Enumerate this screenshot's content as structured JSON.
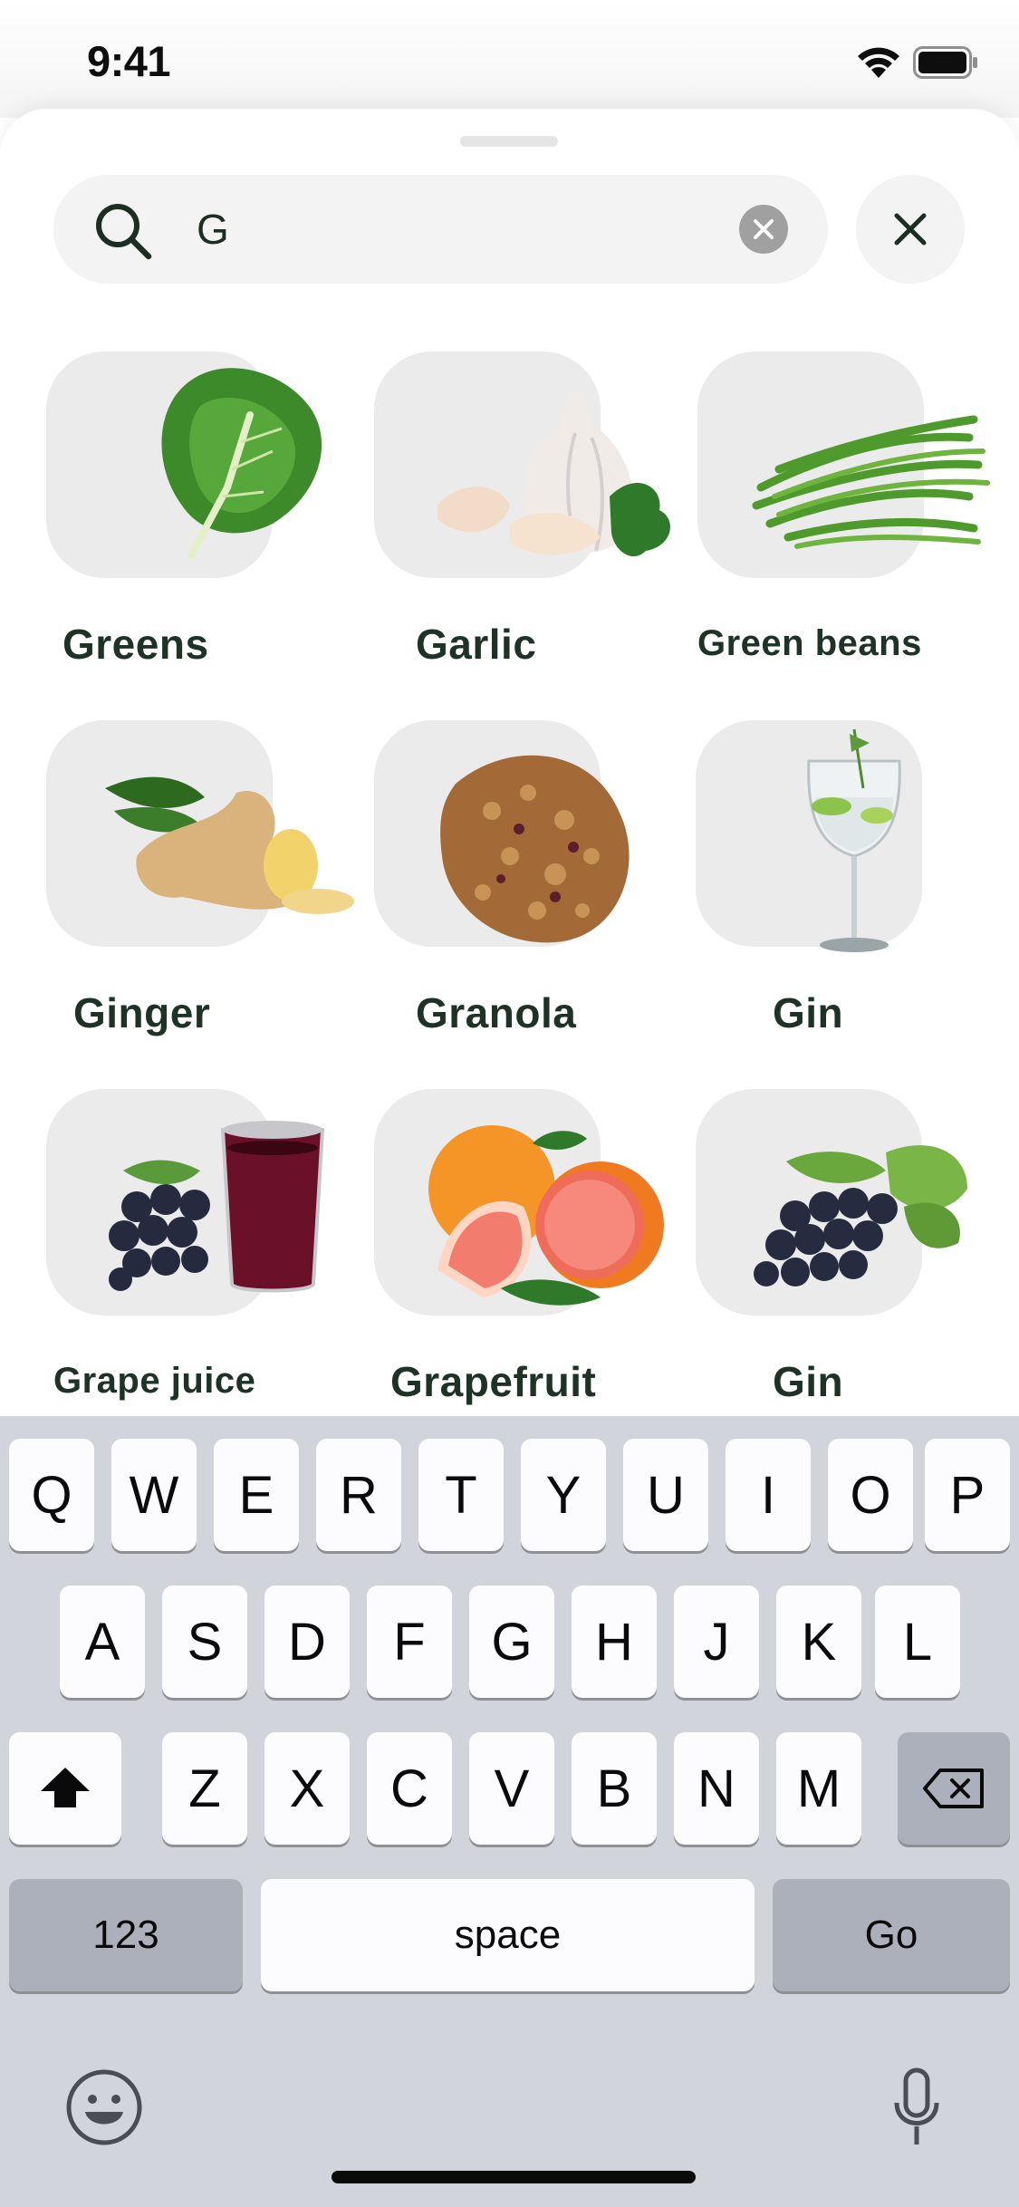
{
  "status": {
    "time": "9:41"
  },
  "search": {
    "value": "G",
    "placeholder": ""
  },
  "results": [
    {
      "label": "Greens",
      "icon": "greens-image"
    },
    {
      "label": "Garlic",
      "icon": "garlic-image"
    },
    {
      "label": "Green beans",
      "icon": "green-beans-image"
    },
    {
      "label": "Ginger",
      "icon": "ginger-image"
    },
    {
      "label": "Granola",
      "icon": "granola-image"
    },
    {
      "label": "Gin",
      "icon": "gin-glass-image"
    },
    {
      "label": "Grape juice",
      "icon": "grape-juice-image"
    },
    {
      "label": "Grapefruit",
      "icon": "grapefruit-image"
    },
    {
      "label": "Gin",
      "icon": "grapes-image"
    }
  ],
  "keyboard": {
    "row1": [
      "Q",
      "W",
      "E",
      "R",
      "T",
      "Y",
      "U",
      "I",
      "O",
      "P"
    ],
    "row2": [
      "A",
      "S",
      "D",
      "F",
      "G",
      "H",
      "J",
      "K",
      "L"
    ],
    "row3": [
      "Z",
      "X",
      "C",
      "V",
      "B",
      "N",
      "M"
    ],
    "numbers_label": "123",
    "space_label": "space",
    "go_label": "Go"
  },
  "colors": {
    "label_text": "#1e3326",
    "tile_background": "#ebebeb",
    "keyboard_background": "#d1d4db"
  }
}
